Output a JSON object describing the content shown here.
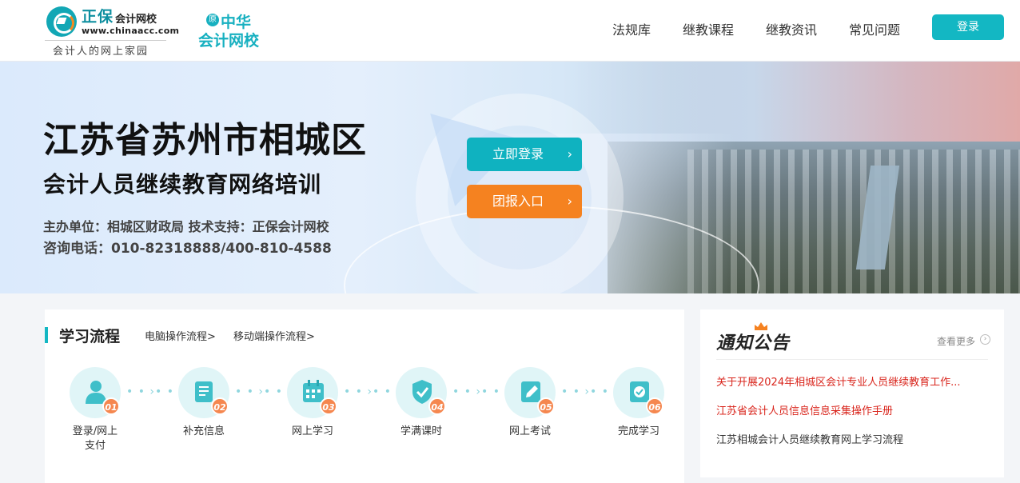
{
  "header": {
    "logo": {
      "brand": "正保",
      "name": "会计网校",
      "url": "www.chinaacc.com",
      "slogan": "会计人的网上家园"
    },
    "zhlogo": {
      "badge": "原",
      "line1": "中华",
      "line2": "会计网校"
    },
    "nav": [
      "法规库",
      "继教课程",
      "继教资讯",
      "常见问题"
    ],
    "login_label": "登录"
  },
  "banner": {
    "title": "江苏省苏州市相城区",
    "subtitle": "会计人员继续教育网络培训",
    "info1": "主办单位：相城区财政局  技术支持：正保会计网校",
    "info2": "咨询电话：010-82318888/400-810-4588",
    "btn_login": "立即登录",
    "btn_group": "团报入口",
    "arrow": "›"
  },
  "flow": {
    "title": "学习流程",
    "links": [
      "电脑操作流程>",
      "移动端操作流程>"
    ],
    "steps": [
      {
        "num": "01",
        "label": "登录/网上支付",
        "icon": "user-icon"
      },
      {
        "num": "02",
        "label": "补充信息",
        "icon": "scroll-icon"
      },
      {
        "num": "03",
        "label": "网上学习",
        "icon": "calendar-icon"
      },
      {
        "num": "04",
        "label": "学满课时",
        "icon": "shield-check-icon"
      },
      {
        "num": "05",
        "label": "网上考试",
        "icon": "edit-icon"
      },
      {
        "num": "06",
        "label": "完成学习",
        "icon": "certificate-icon"
      }
    ],
    "connector": "• • ›• •"
  },
  "notice": {
    "title": "通知公告",
    "more": "查看更多",
    "more_icon": "›",
    "items": [
      {
        "text": "关于开展2024年相城区会计专业人员继续教育工作...",
        "color": "#d9251c"
      },
      {
        "text": "江苏省会计人员信息信息采集操作手册",
        "color": "#d9251c"
      },
      {
        "text": "江苏相城会计人员继续教育网上学习流程",
        "color": "#333333"
      }
    ]
  },
  "colors": {
    "accent": "#13b7c3",
    "orange": "#f58220",
    "number_badge": "#f5874f"
  }
}
